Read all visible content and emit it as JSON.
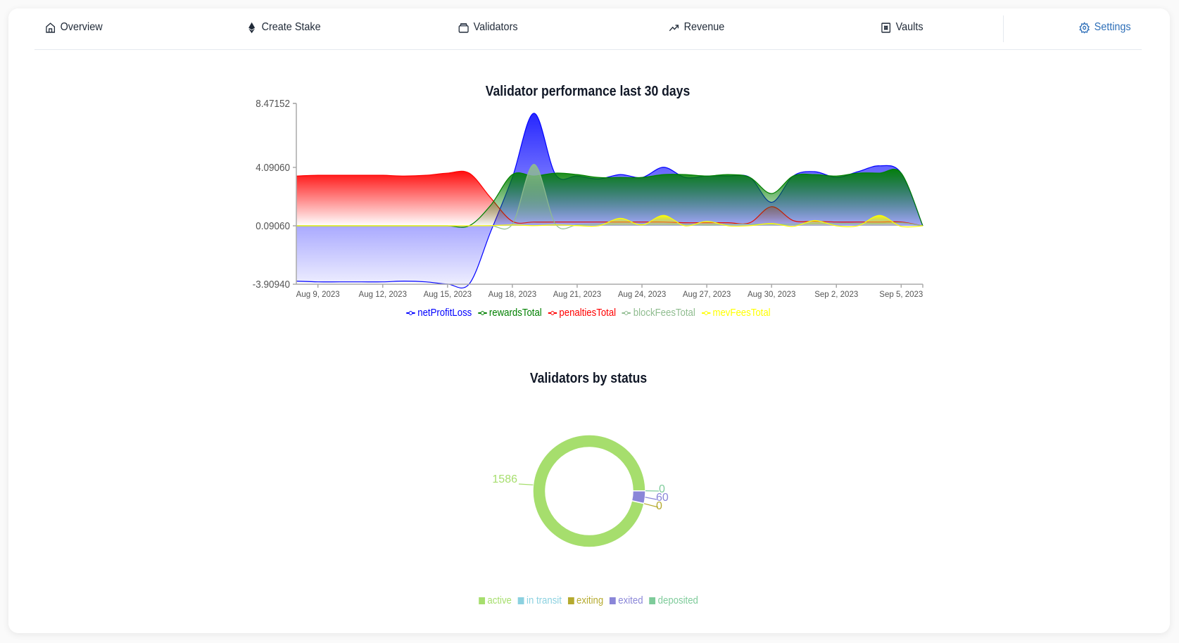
{
  "nav": {
    "items": [
      {
        "label": "Overview",
        "icon": "home-icon"
      },
      {
        "label": "Create Stake",
        "icon": "ethereum-icon"
      },
      {
        "label": "Validators",
        "icon": "wallet-icon"
      },
      {
        "label": "Revenue",
        "icon": "trending-up-icon"
      },
      {
        "label": "Vaults",
        "icon": "vault-icon"
      },
      {
        "label": "Settings",
        "icon": "gear-icon"
      }
    ],
    "active_color": "#2e6fb8"
  },
  "chart_data": [
    {
      "type": "area",
      "title": "Validator performance last 30 days",
      "xlabel": "",
      "ylabel": "",
      "ylim": [
        -3.9094,
        8.47152
      ],
      "yticks": [
        "8.47152",
        "4.09060",
        "0.09060",
        "-3.90940"
      ],
      "ytick_values": [
        8.47152,
        4.0906,
        0.0906,
        -3.9094
      ],
      "xticks": [
        "Aug 9, 2023",
        "Aug 12, 2023",
        "Aug 15, 2023",
        "Aug 18, 2023",
        "Aug 21, 2023",
        "Aug 24, 2023",
        "Aug 27, 2023",
        "Aug 30, 2023",
        "Sep 2, 2023",
        "Sep 5, 2023"
      ],
      "x": [
        "Aug 8",
        "Aug 9",
        "Aug 10",
        "Aug 11",
        "Aug 12",
        "Aug 13",
        "Aug 14",
        "Aug 15",
        "Aug 16",
        "Aug 17",
        "Aug 18",
        "Aug 19",
        "Aug 20",
        "Aug 21",
        "Aug 22",
        "Aug 23",
        "Aug 24",
        "Aug 25",
        "Aug 26",
        "Aug 27",
        "Aug 28",
        "Aug 29",
        "Aug 30",
        "Aug 31",
        "Sep 1",
        "Sep 2",
        "Sep 3",
        "Sep 4",
        "Sep 5",
        "Sep 6"
      ],
      "legend_position": "bottom",
      "series": [
        {
          "name": "netProfitLoss",
          "color": "#0000ff",
          "values": [
            -3.7,
            -3.75,
            -3.75,
            -3.75,
            -3.75,
            -3.7,
            -3.75,
            -3.9,
            -3.9,
            -0.3,
            3.4,
            7.8,
            3.6,
            3.5,
            3.3,
            3.6,
            3.4,
            4.1,
            3.4,
            3.5,
            3.5,
            3.4,
            1.7,
            3.5,
            3.8,
            3.4,
            3.8,
            4.2,
            3.7,
            0.0
          ]
        },
        {
          "name": "rewardsTotal",
          "color": "#008000",
          "values": [
            0,
            0,
            0,
            0,
            0,
            0,
            0,
            0,
            0,
            1.5,
            3.6,
            3.5,
            3.7,
            3.6,
            3.4,
            3.4,
            3.4,
            3.6,
            3.6,
            3.5,
            3.6,
            3.4,
            2.3,
            3.5,
            3.6,
            3.5,
            3.7,
            3.7,
            3.7,
            0.0
          ]
        },
        {
          "name": "penaltiesTotal",
          "color": "#ff0000",
          "values": [
            3.5,
            3.55,
            3.55,
            3.55,
            3.55,
            3.5,
            3.55,
            3.7,
            3.7,
            2.0,
            0.4,
            0.35,
            0.35,
            0.35,
            0.35,
            0.35,
            0.35,
            0.35,
            0.3,
            0.3,
            0.3,
            0.3,
            1.4,
            0.45,
            0.4,
            0.35,
            0.35,
            0.35,
            0.35,
            0.0
          ]
        },
        {
          "name": "blockFeesTotal",
          "color": "#8fbc8f",
          "values": [
            0,
            0,
            0,
            0,
            0,
            0,
            0,
            0,
            0,
            0.1,
            0.2,
            4.3,
            0.2,
            0.15,
            0.2,
            0.2,
            0.2,
            0.2,
            0.2,
            0.15,
            0.2,
            0.2,
            0.2,
            0.2,
            0.25,
            0.25,
            0.25,
            0.25,
            0.3,
            0.0
          ]
        },
        {
          "name": "mevFeesTotal",
          "color": "#ffff00",
          "values": [
            0,
            0,
            0,
            0,
            0,
            0,
            0,
            0,
            0,
            0.1,
            0.15,
            0.1,
            0.15,
            0.1,
            0.0,
            0.6,
            0.15,
            0.8,
            0.0,
            0.4,
            0.0,
            0.1,
            0.25,
            0.05,
            0.45,
            0.0,
            0.0,
            0.8,
            0.05,
            0.0
          ]
        }
      ]
    },
    {
      "type": "pie",
      "title": "Validators by status",
      "donut": true,
      "legend_position": "bottom",
      "slices": [
        {
          "label": "active",
          "value": 1586,
          "color": "#a6de6d"
        },
        {
          "label": "in transit",
          "value": 0,
          "color": "#8bd1e0"
        },
        {
          "label": "exiting",
          "value": 0,
          "color": "#b5aa2f"
        },
        {
          "label": "exited",
          "value": 60,
          "color": "#8a86d8"
        },
        {
          "label": "deposited",
          "value": 0,
          "color": "#7ecb9a"
        }
      ]
    }
  ]
}
